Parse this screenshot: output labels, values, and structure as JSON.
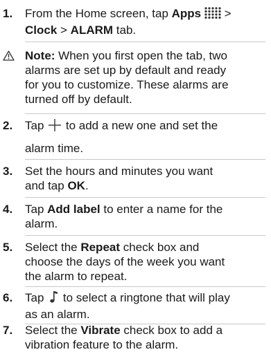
{
  "steps": {
    "s1": {
      "num": "1.",
      "a": "From the Home screen, tap ",
      "b": "Apps",
      "c": " > ",
      "d": "Clock",
      "e": " > ",
      "f": "ALARM",
      "g": " tab."
    },
    "note": {
      "label": "Note:",
      "l1": " When you first open the tab, two",
      "l2": "alarms are set up by default and ready",
      "l3": "for you to customize. These alarms are",
      "l4": "turned off by default."
    },
    "s2": {
      "num": "2.",
      "a": "Tap ",
      "b": " to add a new one and set the",
      "c": "alarm time."
    },
    "s3": {
      "num": "3.",
      "a": "Set the hours and minutes you want",
      "b": "and tap ",
      "c": "OK",
      "d": "."
    },
    "s4": {
      "num": "4.",
      "a": "Tap ",
      "b": "Add label",
      "c": " to enter a name for the",
      "d": "alarm."
    },
    "s5": {
      "num": "5.",
      "a": "Select the ",
      "b": "Repeat",
      "c": " check box and",
      "d": "choose the days of the week you want",
      "e": "the alarm to repeat."
    },
    "s6": {
      "num": "6.",
      "a": "Tap ",
      "b": " to select a ringtone that will play",
      "c": "as an alarm."
    },
    "s7": {
      "num": "7.",
      "a": "Select the ",
      "b": "Vibrate",
      "c": " check box to add a",
      "d": "vibration feature to the alarm."
    }
  },
  "icons": {
    "apps": "apps-grid-icon",
    "add": "plus-icon",
    "ringtone": "music-note-icon",
    "note": "warning-triangle-icon"
  }
}
